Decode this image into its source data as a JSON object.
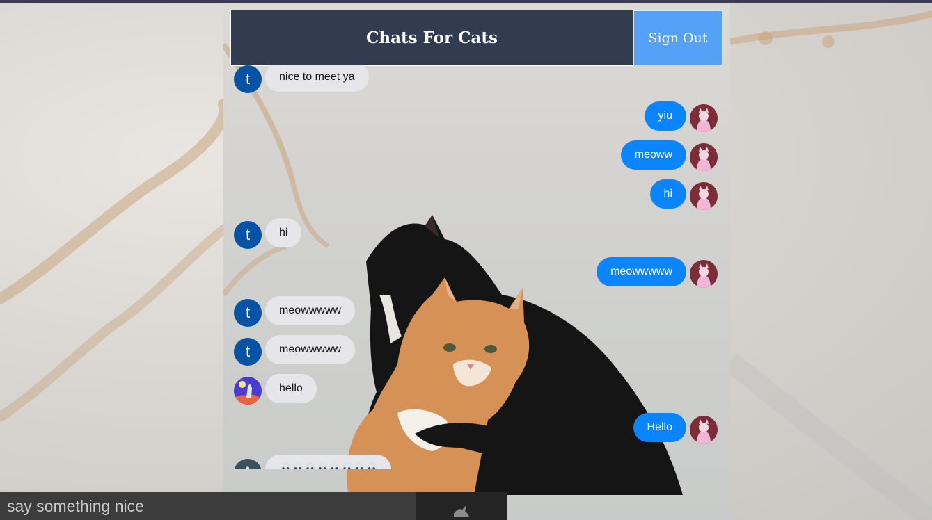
{
  "header": {
    "title": "Chats For Cats",
    "signout_label": "Sign Out"
  },
  "messages": [
    {
      "side": "recv",
      "text": "nice to meet ya",
      "avatar": "t",
      "avatar_type": "letter"
    },
    {
      "side": "sent",
      "text": "yiu",
      "avatar_type": "cat-photo"
    },
    {
      "side": "sent",
      "text": "meoww",
      "avatar_type": "cat-photo"
    },
    {
      "side": "sent",
      "text": "hi",
      "avatar_type": "cat-photo"
    },
    {
      "side": "recv",
      "text": "hi",
      "avatar": "t",
      "avatar_type": "letter"
    },
    {
      "side": "sent",
      "text": "meowwwww",
      "avatar_type": "cat-photo"
    },
    {
      "side": "recv",
      "text": "meowwwww",
      "avatar": "t",
      "avatar_type": "letter"
    },
    {
      "side": "recv",
      "text": "meowwwww",
      "avatar": "t",
      "avatar_type": "letter"
    },
    {
      "side": "recv",
      "text": "hello",
      "avatar_type": "wolf-illustration"
    },
    {
      "side": "sent",
      "text": "Hello",
      "avatar_type": "cat-photo"
    },
    {
      "side": "recv",
      "text": "💀💀💀💀💀💀💀💀",
      "avatar": "A",
      "avatar_type": "letter-gray"
    }
  ],
  "composer": {
    "placeholder": "say something nice",
    "send_icon": "dove-icon"
  }
}
